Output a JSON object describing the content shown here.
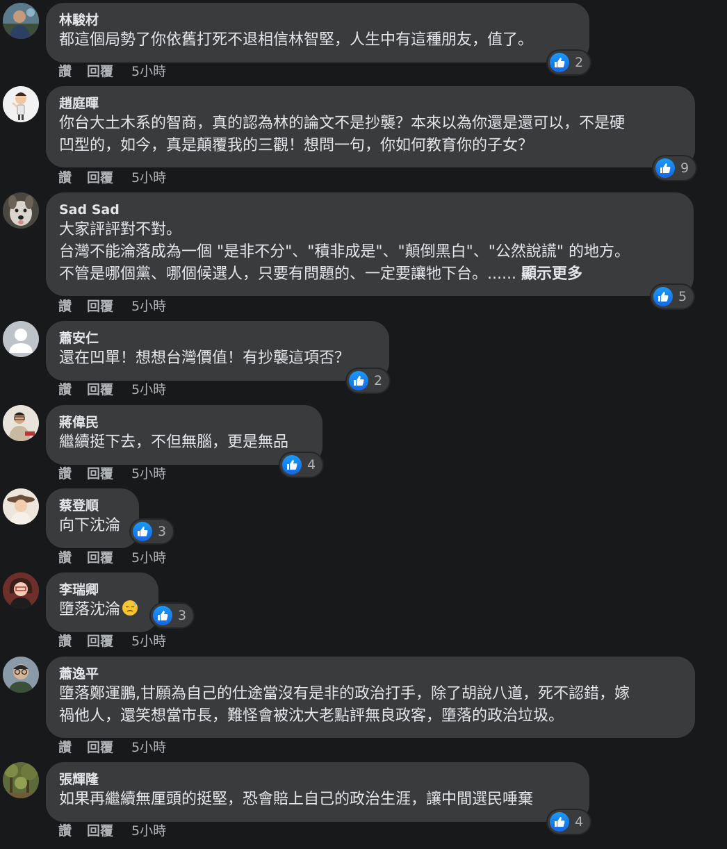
{
  "actions": {
    "like": "讚",
    "reply": "回覆",
    "time": "5小時"
  },
  "colors": {
    "background": "#18191a",
    "bubble": "#3a3b3c",
    "text": "#e4e6eb",
    "secondary_text": "#b0b3b8",
    "like_blue": "#1877f2"
  },
  "comments": [
    {
      "author": "林駿材",
      "lines": [
        "都這個局勢了你依舊打死不退相信林智堅，人生中有這種朋友，值了。"
      ],
      "likes": "2",
      "avatar_icon": "man-avatar-icon"
    },
    {
      "author": "趙庭暉",
      "lines": [
        "你台大土木系的智商，真的認為林的論文不是抄襲？本來以為你還是還可以，不是硬",
        "凹型的，如今，真是顛覆我的三觀！想問一句，你如何教育你的子女？"
      ],
      "likes": "9",
      "avatar_icon": "cartoon-avatar-icon"
    },
    {
      "author": "Sad Sad",
      "lines": [
        "大家評評對不對。",
        "台灣不能淪落成為一個 \"是非不分\"、\"積非成是\"、\"顛倒黑白\"、\"公然說謊\" 的地方。",
        "不管是哪個黨、哪個候選人，只要有問題的、一定要讓牠下台。......"
      ],
      "see_more": "顯示更多",
      "likes": "5",
      "avatar_icon": "dog-avatar-icon"
    },
    {
      "author": "蕭安仁",
      "lines": [
        "還在凹單！想想台灣價值！有抄襲這項否？"
      ],
      "likes": "2",
      "avatar_icon": "default-avatar-icon"
    },
    {
      "author": "蔣偉民",
      "lines": [
        "繼續挺下去，不但無腦，更是無品"
      ],
      "likes": "4",
      "avatar_icon": "man-avatar-icon"
    },
    {
      "author": "蔡登順",
      "lines": [
        "向下沈淪"
      ],
      "likes": "3",
      "avatar_icon": "woman-hat-avatar-icon"
    },
    {
      "author": "李瑞卿",
      "lines": [
        "墮落沈淪"
      ],
      "emoji": "downcast-sweat-emoji",
      "likes": "3",
      "avatar_icon": "woman-avatar-icon"
    },
    {
      "author": "蕭逸平",
      "lines": [
        "墮落鄭運鵬,甘願為自己的仕途當沒有是非的政治打手，除了胡說八道，死不認錯，嫁",
        "禍他人，還笑想當市長，難怪會被沈大老點評無良政客，墮落的政治垃圾。"
      ],
      "likes": "",
      "avatar_icon": "man-glasses-avatar-icon"
    },
    {
      "author": "張輝隆",
      "lines": [
        "如果再繼續無厘頭的挺堅，恐會賠上自己的政治生涯，讓中間選民唾棄"
      ],
      "likes": "4",
      "avatar_icon": "forest-avatar-icon"
    }
  ]
}
